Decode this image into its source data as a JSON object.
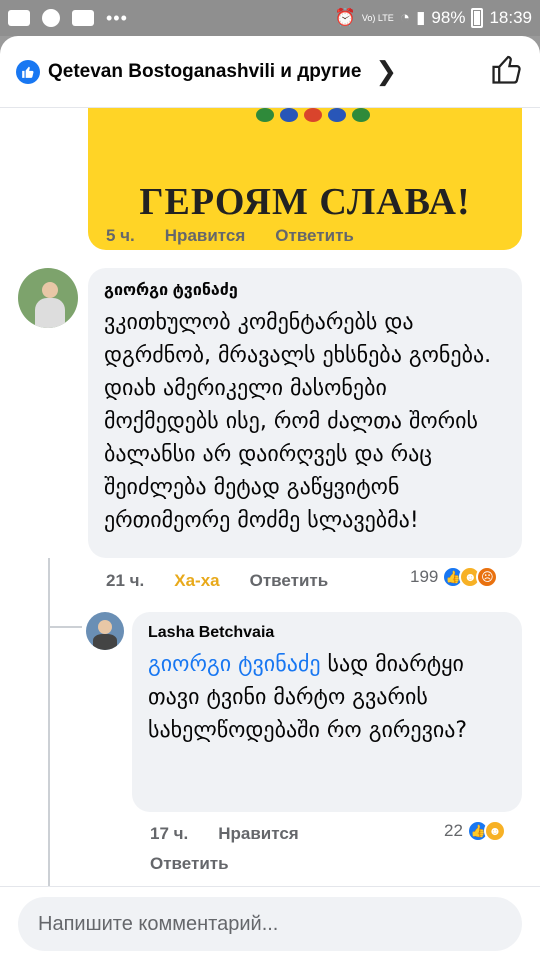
{
  "status_bar": {
    "lte_label": "Vo) LTE",
    "battery": "98%",
    "time": "18:39"
  },
  "header": {
    "title": "Qetevan Bostoganashvili и другие"
  },
  "banner": {
    "text": "ГЕРОЯМ СЛАВА!"
  },
  "post_meta": {
    "time": "5 ч.",
    "like": "Нравится",
    "reply": "Ответить"
  },
  "comment1": {
    "author": "გიორგი ტვინაძე",
    "text": "ვკითხულობ კომენტარებს და დგრძნობ, მრავალს ეხსნება გონება. დიახ ამერიკელი მასონები მოქმედებს ისე, რომ ძალთა შორის ბალანსი არ დაირღვეს და რაც შეიძლება მეტად გაწყვიტონ ერთიმეორე მოძმე სლავებმა!",
    "time": "21 ч.",
    "reaction_label": "Ха-ха",
    "reply": "Ответить",
    "reaction_count": "199"
  },
  "comment2": {
    "author": "Lasha Betchvaia",
    "mention": "გიორგი ტვინაძე",
    "text": " სად მიარტყი თავი ტვინი მარტო გვარის სახელწოდებაში რო გირევია?",
    "time": "17 ч.",
    "like": "Нравится",
    "reply": "Ответить",
    "reaction_count": "22"
  },
  "composer": {
    "placeholder": "Напишите комментарий..."
  },
  "colors": {
    "accent": "#1877f2",
    "haha": "#e8a91b",
    "banner": "#ffd426"
  }
}
